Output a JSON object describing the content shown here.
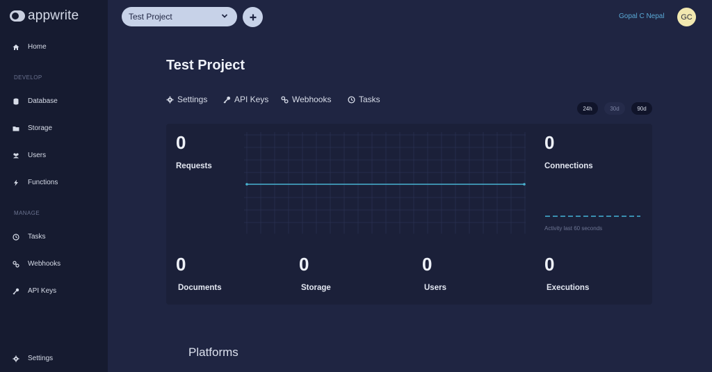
{
  "app": {
    "logo_text": "appwrite"
  },
  "sidebar": {
    "home": "Home",
    "develop_section": "DEVELOP",
    "develop_items": [
      "Database",
      "Storage",
      "Users",
      "Functions"
    ],
    "manage_section": "MANAGE",
    "manage_items": [
      "Tasks",
      "Webhooks",
      "API Keys"
    ],
    "settings": "Settings"
  },
  "topbar": {
    "project_selected": "Test Project",
    "user_name": "Gopal C Nepal",
    "avatar_initials": "GC"
  },
  "main": {
    "title": "Test Project",
    "tabs": [
      "Settings",
      "API Keys",
      "Webhooks",
      "Tasks"
    ],
    "ranges": {
      "r24h": "24h",
      "r30d": "30d",
      "r90d": "90d"
    },
    "stats": {
      "requests": {
        "value": "0",
        "label": "Requests"
      },
      "connections": {
        "value": "0",
        "label": "Connections"
      },
      "documents": {
        "value": "0",
        "label": "Documents"
      },
      "storage": {
        "value": "0",
        "label": "Storage"
      },
      "users": {
        "value": "0",
        "label": "Users"
      },
      "executions": {
        "value": "0",
        "label": "Executions"
      }
    },
    "activity_label": "Activity last 60 seconds",
    "platforms_heading": "Platforms"
  },
  "colors": {
    "background": "#1f2542",
    "sidebar": "#161b30",
    "accent": "#5aa9d6",
    "chart_line": "#49b3d1"
  }
}
